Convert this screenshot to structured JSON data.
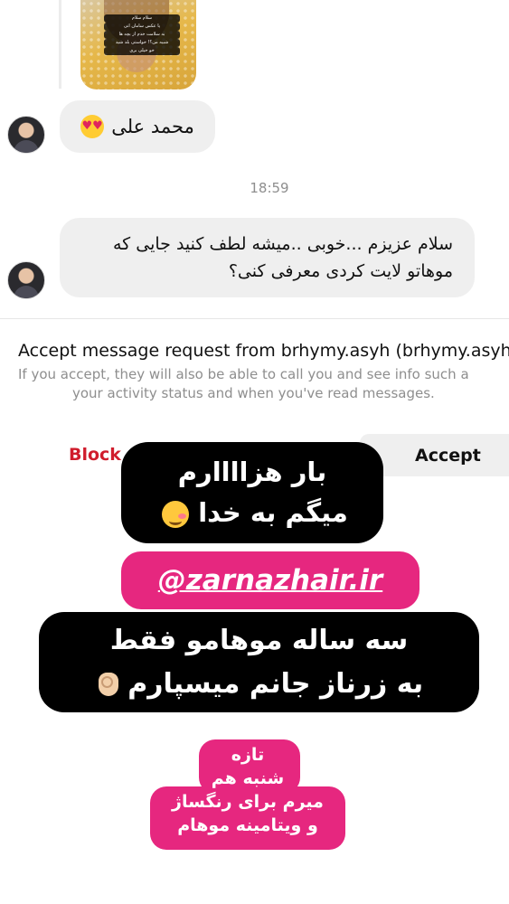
{
  "photo": {
    "caption_lines": [
      "سلام سلام",
      "یا عکس سامان انی",
      "به سلامت خدم از بچه ها",
      "شبیه من؟! خواستی بلد شید",
      "خو خیلی بری"
    ]
  },
  "messages": [
    {
      "sender": "محمد علی",
      "text": "محمد علی",
      "emoji": "heart-eyes-emoji"
    },
    {
      "timestamp": "18:59"
    },
    {
      "text_line1": "سلام عزیزم ...خوبی ..میشه لطف کنید جایی که",
      "text_line2": "موهاتو لایت کردی معرفی کنی؟"
    }
  ],
  "request": {
    "title": "Accept message request from brhymy.asyh (brhymy.asyh)",
    "subtitle_line1": "If you accept, they will also be able to call you and see info such a",
    "subtitle_line2": "your activity status and when you've read messages."
  },
  "actions": {
    "block_label": "Block",
    "accept_label": "Accept"
  },
  "stickers": {
    "s1_line1": "بار هزاااارم",
    "s1_line2": "میگم به خدا",
    "handle": "@zarnazhair.ir",
    "s3_line1": "سه ساله موهامو فقط",
    "s3_line2": "به زرناز جانم میسپارم",
    "s4_lines": [
      "تازه",
      "شنبه هم",
      "میرم برای رنگساژ",
      "و ویتامینه موهام"
    ]
  },
  "colors": {
    "block_red": "#d01c2c",
    "sticker_pink": "#e6277f",
    "bubble_gray": "#efefef"
  }
}
